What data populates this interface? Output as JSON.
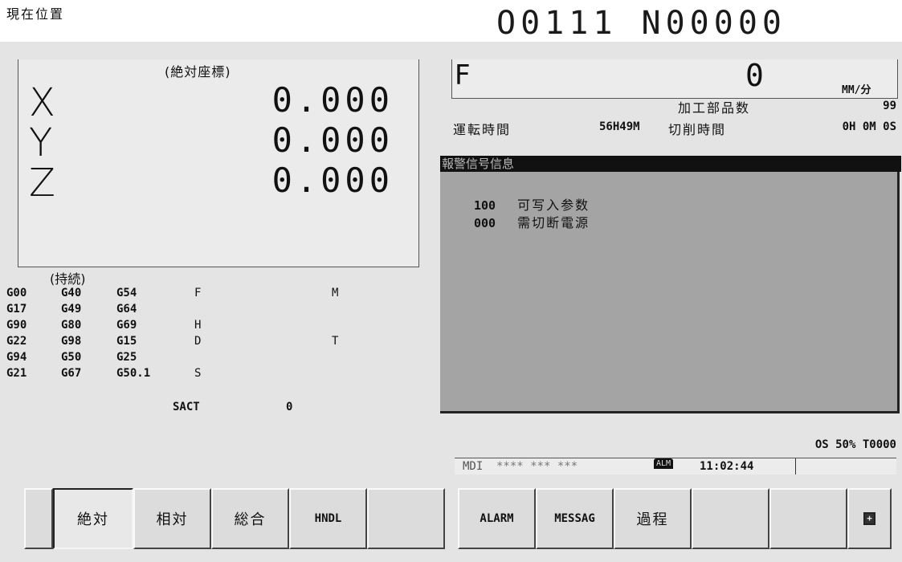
{
  "header": {
    "title": "現在位置",
    "program": "O0111 N00000"
  },
  "position": {
    "header": "(絶対座標)",
    "axes": [
      {
        "name": "X",
        "value": "0.000"
      },
      {
        "name": "Y",
        "value": "0.000"
      },
      {
        "name": "Z",
        "value": "0.000"
      }
    ]
  },
  "modal": {
    "header": "(持続)",
    "rows": [
      [
        "G00",
        "G40",
        "G54",
        "F",
        "M"
      ],
      [
        "G17",
        "G49",
        "G64",
        "",
        ""
      ],
      [
        "G90",
        "G80",
        "G69",
        "H",
        ""
      ],
      [
        "G22",
        "G98",
        "G15",
        "D",
        "T"
      ],
      [
        "G94",
        "G50",
        "G25",
        "",
        ""
      ],
      [
        "G21",
        "G67",
        "G50.1",
        "S",
        ""
      ]
    ],
    "sact_label": "SACT",
    "sact_value": "0"
  },
  "feed": {
    "label": "F",
    "value": "0",
    "unit": "MM/分"
  },
  "stats": {
    "parts_label": "加工部品数",
    "parts_value": "99",
    "run_label": "運転時間",
    "run_value": "56H49M",
    "cut_label": "切削時間",
    "cut_value": "0H 0M 0S"
  },
  "alarm": {
    "title": "報警信号信息",
    "items": [
      {
        "code": "100",
        "text": "可写入参数"
      },
      {
        "code": "000",
        "text": "需切断電源"
      }
    ]
  },
  "status": {
    "override": "OS 50% T0000",
    "mode": "MDI",
    "stars": "**** *** ***",
    "alm": "ALM",
    "time": "11:02:44"
  },
  "softkeys_left": [
    "",
    "絶対",
    "相対",
    "総合",
    "HNDL",
    ""
  ],
  "softkeys_right": [
    "ALARM",
    "MESSAG",
    "過程",
    "",
    "",
    "+"
  ],
  "colors": {
    "panel": "#e4e4e4",
    "alarm_bg": "#a4a4a4",
    "title_bar": "#111111"
  }
}
